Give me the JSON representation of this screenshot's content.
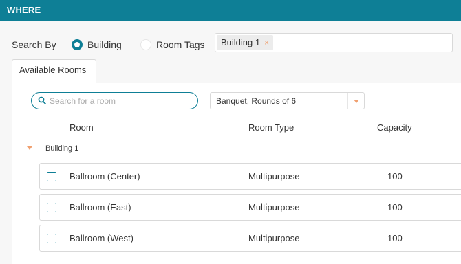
{
  "header": {
    "title": "WHERE"
  },
  "search_by": {
    "label": "Search By",
    "options": [
      {
        "label": "Building",
        "selected": true
      },
      {
        "label": "Room Tags",
        "selected": false
      }
    ],
    "tags": [
      {
        "label": "Building 1",
        "remove": "×"
      }
    ]
  },
  "tabs": [
    {
      "label": "Available Rooms",
      "active": true
    }
  ],
  "room_search": {
    "placeholder": "Search for a room",
    "value": ""
  },
  "setup_select": {
    "value": "Banquet, Rounds of 6"
  },
  "columns": {
    "room": "Room",
    "room_type": "Room Type",
    "capacity": "Capacity"
  },
  "groups": [
    {
      "label": "Building 1",
      "rooms": [
        {
          "name": "Ballroom (Center)",
          "type": "Multipurpose",
          "capacity": "100",
          "checked": false
        },
        {
          "name": "Ballroom (East)",
          "type": "Multipurpose",
          "capacity": "100",
          "checked": false
        },
        {
          "name": "Ballroom (West)",
          "type": "Multipurpose",
          "capacity": "100",
          "checked": false
        }
      ]
    }
  ],
  "colors": {
    "accent": "#0e7f96",
    "caret": "#f0a070"
  }
}
